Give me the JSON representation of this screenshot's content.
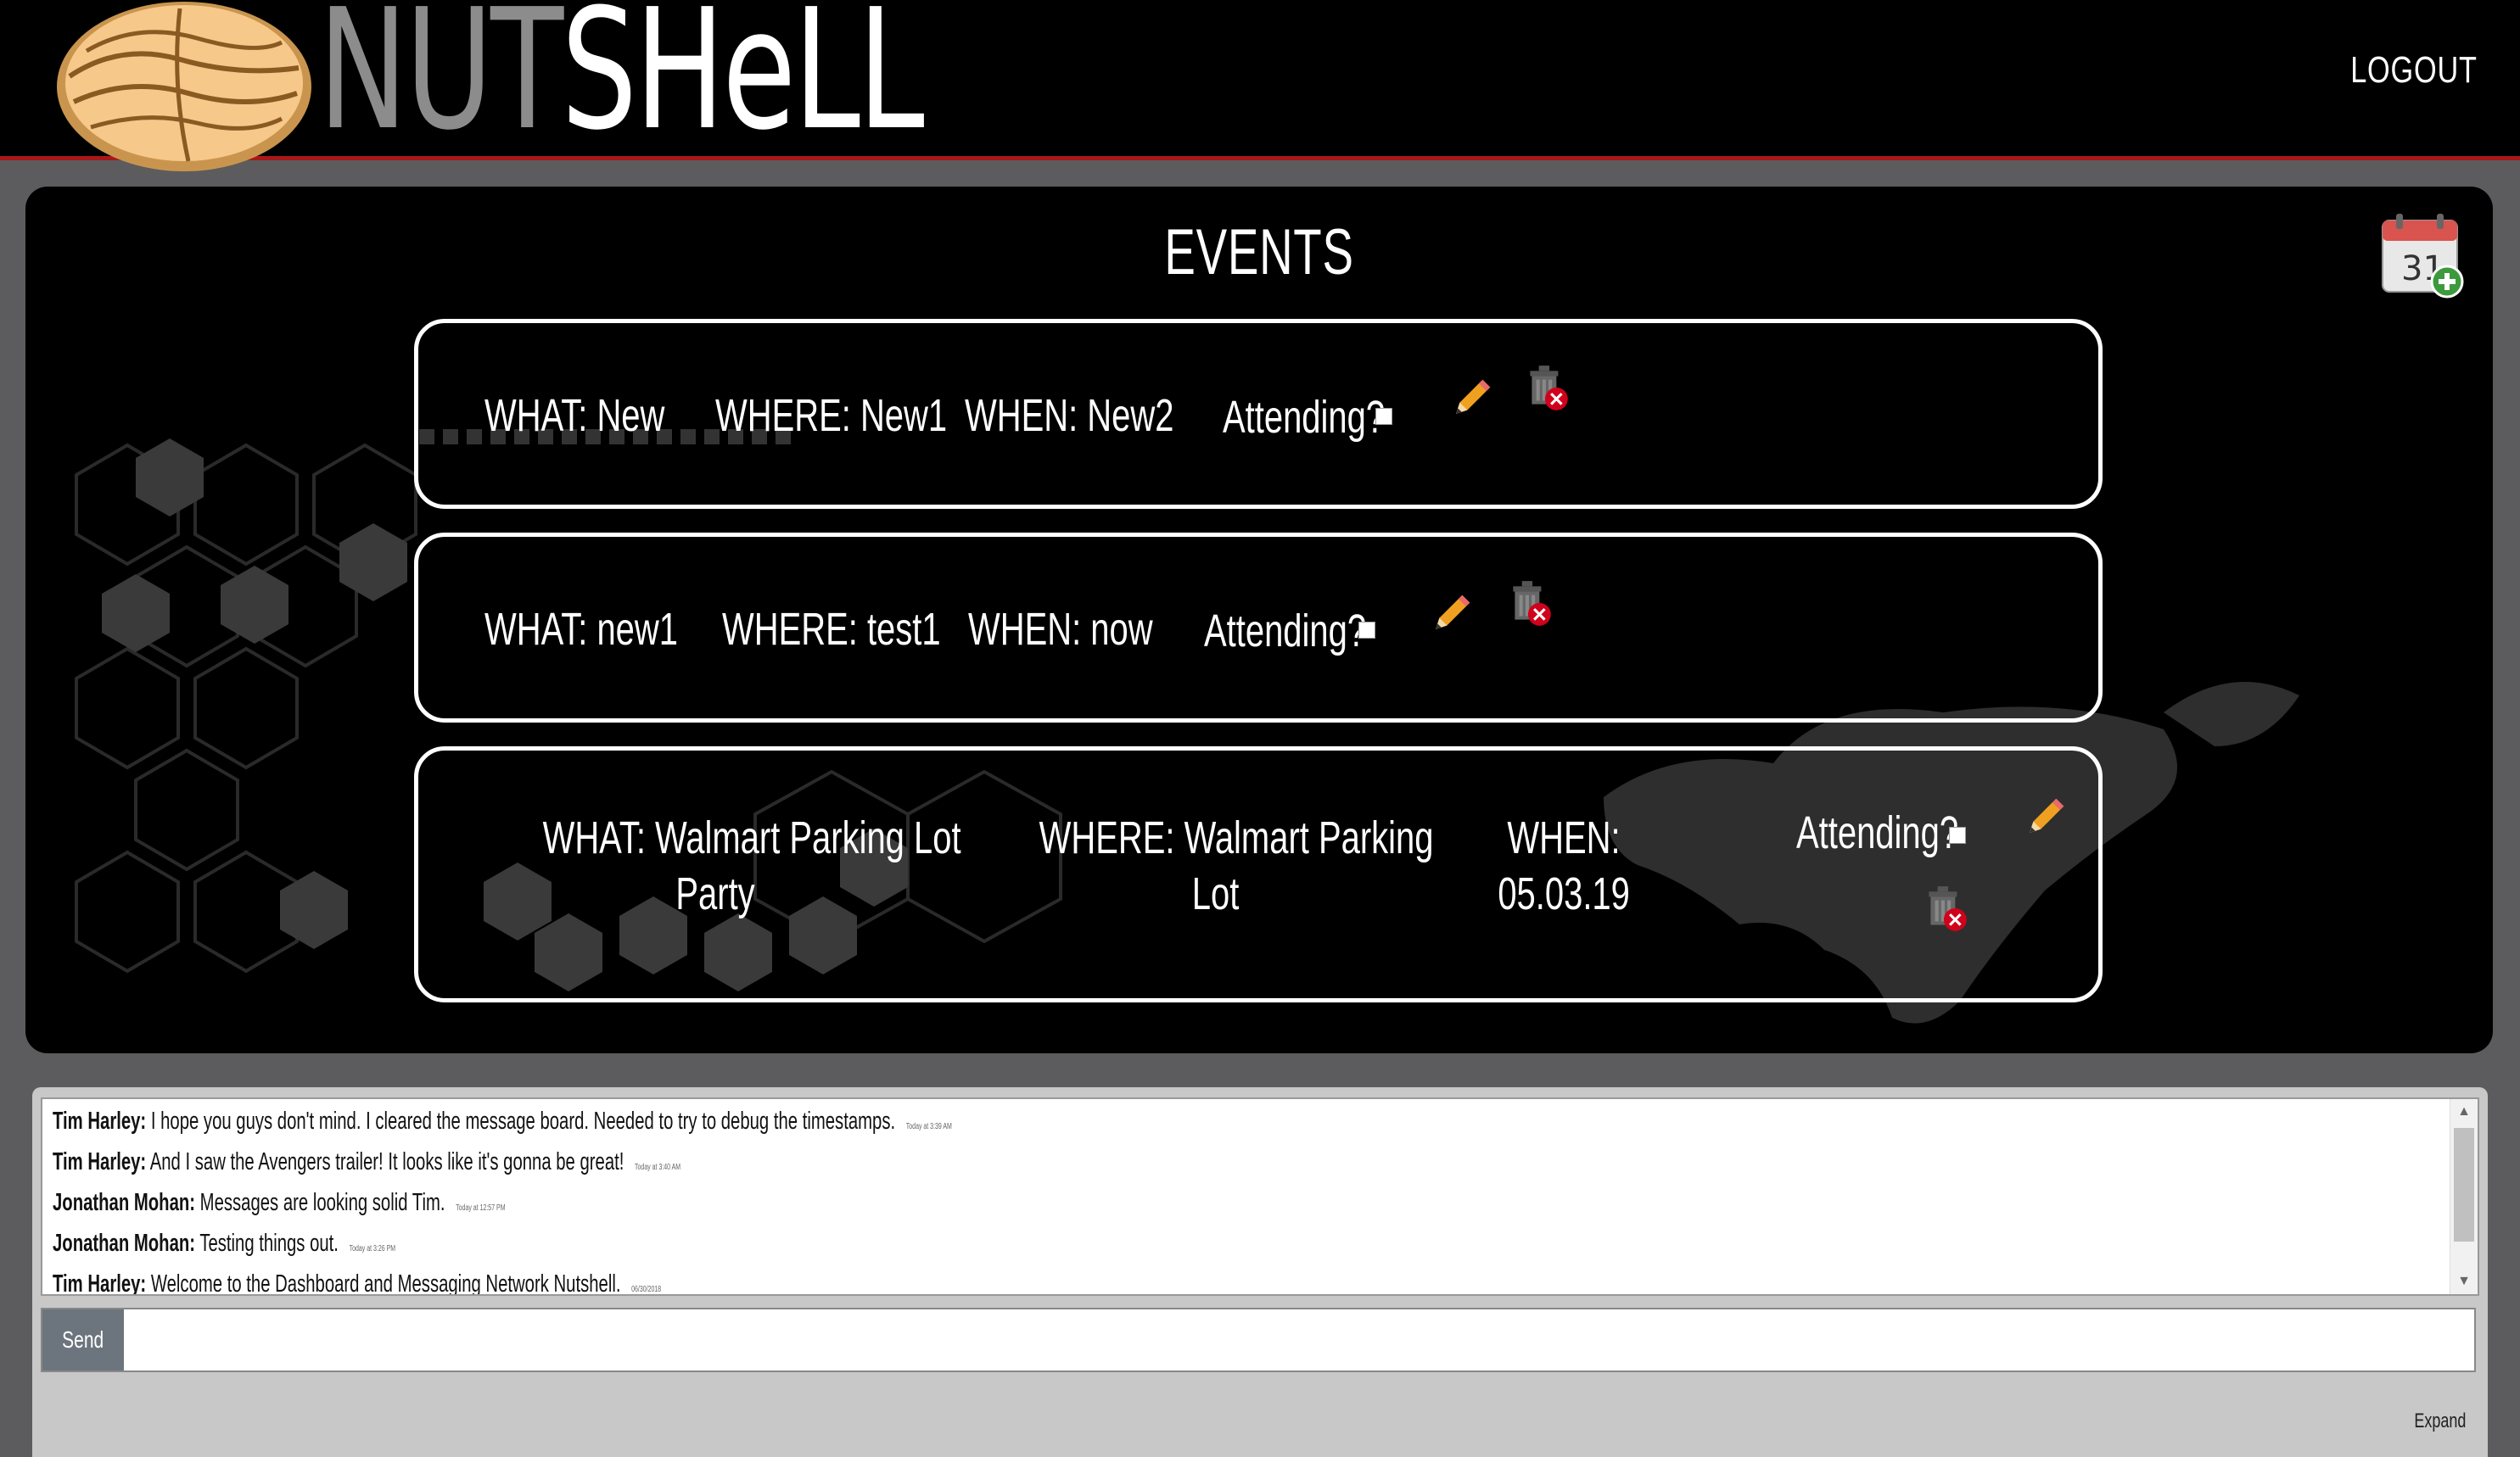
{
  "header": {
    "logo_part1": "NUT",
    "logo_part2": "SHeLL",
    "logout_label": "LOGOUT"
  },
  "events": {
    "title": "EVENTS",
    "calendar_icon_day": "31",
    "items": [
      {
        "what": "WHAT: New",
        "where": "WHERE: New1",
        "when": "WHEN: New2",
        "attending": "Attending?"
      },
      {
        "what": "WHAT: new1",
        "where": "WHERE: test1",
        "when": "WHEN: now",
        "attending": "Attending?"
      },
      {
        "what_line1": "WHAT: Walmart Parking Lot",
        "what_line2": "Party",
        "where_line1": "WHERE: Walmart Parking",
        "where_line2": "Lot",
        "when_line1": "WHEN:",
        "when_line2": "05.03.19",
        "attending": "Attending?"
      }
    ]
  },
  "chat": {
    "messages": [
      {
        "author": "Tim Harley:",
        "text": "I hope you guys don't mind. I cleared the message board. Needed to try to debug the timestamps.",
        "time": "Today at 3:39 AM"
      },
      {
        "author": "Tim Harley:",
        "text": "And I saw the Avengers trailer! It looks like it's gonna be great!",
        "time": "Today at 3:40 AM"
      },
      {
        "author": "Jonathan Mohan:",
        "text": "Messages are looking solid Tim.",
        "time": "Today at 12:57 PM"
      },
      {
        "author": "Jonathan Mohan:",
        "text": "Testing things out.",
        "time": "Today at 3:26 PM"
      },
      {
        "author": "Tim Harley:",
        "text": "Welcome to the Dashboard and Messaging Network Nutshell.",
        "time": "06/30/2018"
      }
    ],
    "send_label": "Send",
    "input_value": "",
    "expand_label": "Expand"
  },
  "colors": {
    "header_bg": "#000000",
    "header_accent": "#a81818",
    "page_bg": "#5c5c5e",
    "chat_bg": "#c8c8c8",
    "send_button": "#6c757d"
  },
  "icons": [
    "walnut-logo-icon",
    "calendar-add-icon",
    "pencil-edit-icon",
    "trash-delete-icon"
  ]
}
